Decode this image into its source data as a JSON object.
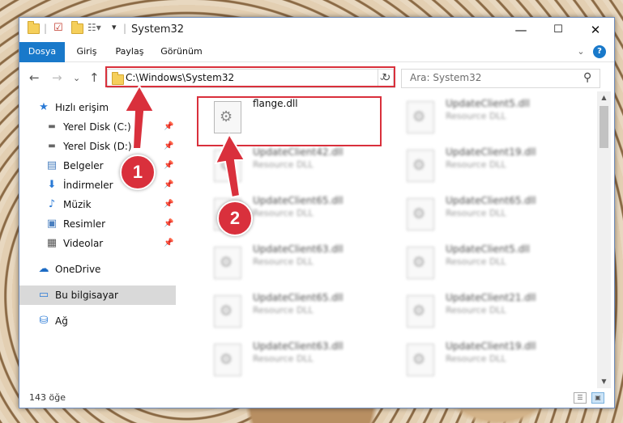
{
  "window": {
    "title": "System32",
    "controls": {
      "minimize": "—",
      "maximize": "☐",
      "close": "✕"
    }
  },
  "ribbon": {
    "tabs": [
      "Dosya",
      "Giriş",
      "Paylaş",
      "Görünüm"
    ],
    "expand": "⌄",
    "help": "?"
  },
  "navigation": {
    "back": "←",
    "forward": "→",
    "recent": "⌄",
    "up": "↑",
    "address": "C:\\Windows\\System32",
    "address_dropdown": "⌄",
    "refresh": "↻",
    "search_placeholder": "Ara: System32",
    "search_icon": "⚲"
  },
  "sidebar": {
    "quick_access": "Hızlı erişim",
    "items": [
      {
        "label": "Yerel Disk (C:)",
        "icon": "drive-icon",
        "pinned": true
      },
      {
        "label": "Yerel Disk (D:)",
        "icon": "drive-icon",
        "pinned": true
      },
      {
        "label": "Belgeler",
        "icon": "documents-icon",
        "pinned": true
      },
      {
        "label": "İndirmeler",
        "icon": "downloads-icon",
        "pinned": true
      },
      {
        "label": "Müzik",
        "icon": "music-icon",
        "pinned": true
      },
      {
        "label": "Resimler",
        "icon": "pictures-icon",
        "pinned": true
      },
      {
        "label": "Videolar",
        "icon": "videos-icon",
        "pinned": true
      }
    ],
    "onedrive": "OneDrive",
    "this_pc": "Bu bilgisayar",
    "network": "Ağ"
  },
  "files": [
    {
      "name": "flange.dll",
      "type": ""
    },
    {
      "name": "UpdateClient5.dll",
      "type": "Resource DLL"
    },
    {
      "name": "UpdateClient42.dll",
      "type": "Resource DLL"
    },
    {
      "name": "UpdateClient19.dll",
      "type": "Resource DLL"
    },
    {
      "name": "UpdateClient65.dll",
      "type": "Resource DLL"
    },
    {
      "name": "UpdateClient65.dll",
      "type": "Resource DLL"
    },
    {
      "name": "UpdateClient63.dll",
      "type": "Resource DLL"
    },
    {
      "name": "UpdateClient5.dll",
      "type": "Resource DLL"
    },
    {
      "name": "UpdateClient65.dll",
      "type": "Resource DLL"
    },
    {
      "name": "UpdateClient21.dll",
      "type": "Resource DLL"
    },
    {
      "name": "UpdateClient63.dll",
      "type": "Resource DLL"
    },
    {
      "name": "UpdateClient19.dll",
      "type": "Resource DLL"
    }
  ],
  "status": {
    "item_count": "143 öğe"
  },
  "annotations": {
    "step1": "1",
    "step2": "2",
    "accent_color": "#d9303c"
  }
}
